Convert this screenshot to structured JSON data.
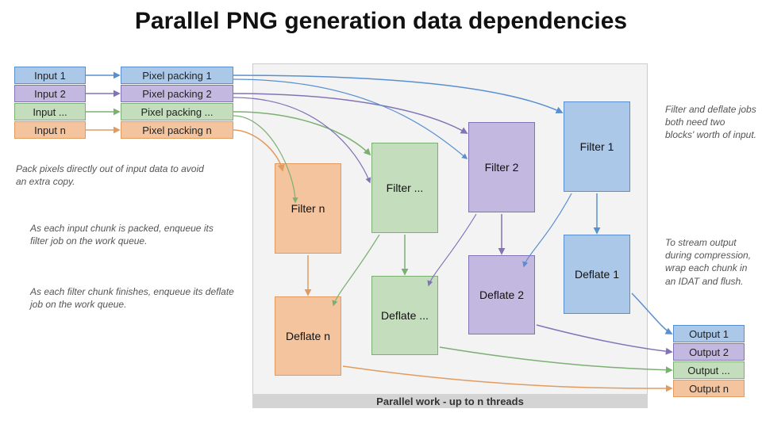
{
  "title": "Parallel PNG generation data dependencies",
  "inputs": [
    "Input 1",
    "Input 2",
    "Input ...",
    "Input n"
  ],
  "packing": [
    "Pixel packing 1",
    "Pixel packing 2",
    "Pixel packing ...",
    "Pixel packing n"
  ],
  "filters": [
    "Filter 1",
    "Filter 2",
    "Filter ...",
    "Filter n"
  ],
  "deflates": [
    "Deflate 1",
    "Deflate 2",
    "Deflate ...",
    "Deflate n"
  ],
  "outputs": [
    "Output 1",
    "Output 2",
    "Output ...",
    "Output n"
  ],
  "annotations": {
    "pack": "Pack pixels directly out of input data to avoid an extra copy.",
    "enqueue_filter": "As each input chunk is packed, enqueue its filter job on the work queue.",
    "enqueue_deflate": "As each filter chunk finishes, enqueue its deflate job on the work queue.",
    "need_two": "Filter and deflate jobs both need two blocks' worth of input.",
    "stream_out": "To stream output during compression, wrap each chunk in an IDAT and flush."
  },
  "parallel_caption": "Parallel work - up to n threads",
  "colors": {
    "blue": "#5a8fcf",
    "purple": "#8373b5",
    "green": "#7bb072",
    "orange": "#e29b5e"
  }
}
